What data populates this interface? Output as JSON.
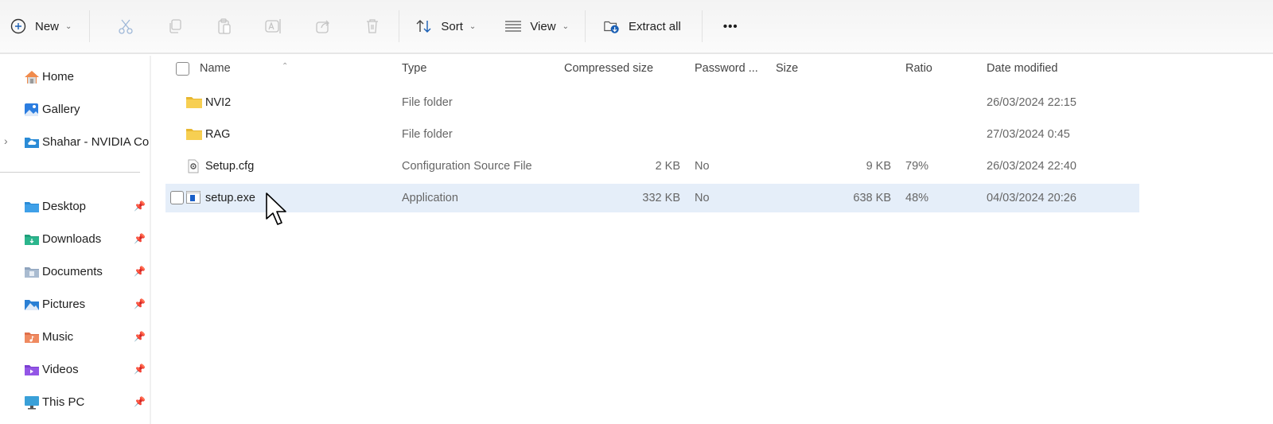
{
  "toolbar": {
    "new_label": "New",
    "sort_label": "Sort",
    "view_label": "View",
    "extract_label": "Extract all",
    "more_label": "•••",
    "disabled_actions": [
      "cut",
      "copy",
      "paste",
      "rename",
      "share",
      "delete"
    ]
  },
  "sidebar": {
    "top_items": [
      {
        "label": "Home",
        "icon": "home-icon"
      },
      {
        "label": "Gallery",
        "icon": "gallery-icon"
      },
      {
        "label": "Shahar - NVIDIA Co",
        "icon": "cloud-folder-icon",
        "expandable": true
      }
    ],
    "pinned_items": [
      {
        "label": "Desktop",
        "icon": "desktop-folder-icon"
      },
      {
        "label": "Downloads",
        "icon": "downloads-folder-icon"
      },
      {
        "label": "Documents",
        "icon": "documents-folder-icon"
      },
      {
        "label": "Pictures",
        "icon": "pictures-folder-icon"
      },
      {
        "label": "Music",
        "icon": "music-folder-icon"
      },
      {
        "label": "Videos",
        "icon": "videos-folder-icon"
      },
      {
        "label": "This PC",
        "icon": "computer-icon"
      }
    ]
  },
  "columns": {
    "name": "Name",
    "type": "Type",
    "compressed_size": "Compressed size",
    "password": "Password ...",
    "size": "Size",
    "ratio": "Ratio",
    "date_modified": "Date modified"
  },
  "files": [
    {
      "name": "NVI2",
      "type": "File folder",
      "compressed_size": "",
      "password": "",
      "size": "",
      "ratio": "",
      "date_modified": "26/03/2024 22:15",
      "icon": "folder-icon",
      "selected": false
    },
    {
      "name": "RAG",
      "type": "File folder",
      "compressed_size": "",
      "password": "",
      "size": "",
      "ratio": "",
      "date_modified": "27/03/2024 0:45",
      "icon": "folder-icon",
      "selected": false
    },
    {
      "name": "Setup.cfg",
      "type": "Configuration Source File",
      "compressed_size": "2 KB",
      "password": "No",
      "size": "9 KB",
      "ratio": "79%",
      "date_modified": "26/03/2024 22:40",
      "icon": "config-file-icon",
      "selected": false
    },
    {
      "name": "setup.exe",
      "type": "Application",
      "compressed_size": "332 KB",
      "password": "No",
      "size": "638 KB",
      "ratio": "48%",
      "date_modified": "04/03/2024 20:26",
      "icon": "application-icon",
      "selected": true
    }
  ],
  "colors": {
    "selection": "#e5eef9",
    "folder": "#f4c542",
    "accent": "#1a73e8"
  }
}
